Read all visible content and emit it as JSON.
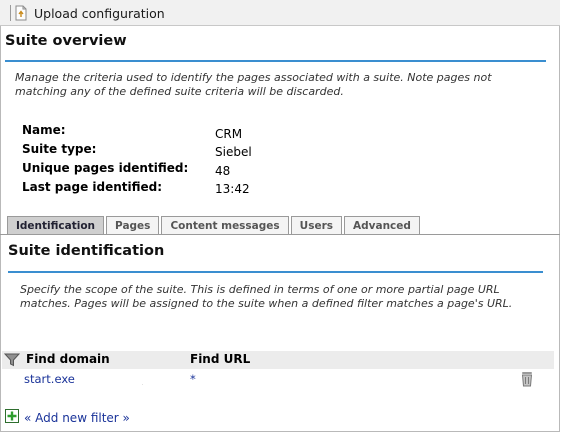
{
  "toolbar": {
    "upload_label": "Upload configuration",
    "upload_icon": "upload-document-icon"
  },
  "overview": {
    "title": "Suite overview",
    "description_line1": "Manage the criteria used to identify the pages associated with a suite. Note pages not",
    "description_line2": "matching any of the defined suite criteria will be discarded.",
    "fields": [
      {
        "label": "Name:",
        "value": "CRM"
      },
      {
        "label": "Suite type:",
        "value": "Siebel"
      },
      {
        "label": "Unique pages identified:",
        "value": "48"
      },
      {
        "label": "Last page identified:",
        "value": "13:42"
      }
    ]
  },
  "tabs": [
    {
      "label": "Identification",
      "active": true
    },
    {
      "label": "Pages",
      "active": false
    },
    {
      "label": "Content messages",
      "active": false
    },
    {
      "label": "Users",
      "active": false
    },
    {
      "label": "Advanced",
      "active": false
    }
  ],
  "identification": {
    "title": "Suite identification",
    "description_line1": "Specify the scope of the suite. This is defined in terms of one or more partial page URL",
    "description_line2": "matches. Pages will be assigned to the suite when a defined filter matches a page's URL."
  },
  "filters": {
    "columns": [
      "Find domain",
      "Find URL"
    ],
    "rows": [
      {
        "domain": "start.exe",
        "url": "*"
      }
    ],
    "add_label": "« Add new filter »"
  },
  "colors": {
    "accent_rule": "#3a8ed0",
    "link": "#1a3399",
    "add_icon_green": "#2e9e2e"
  }
}
